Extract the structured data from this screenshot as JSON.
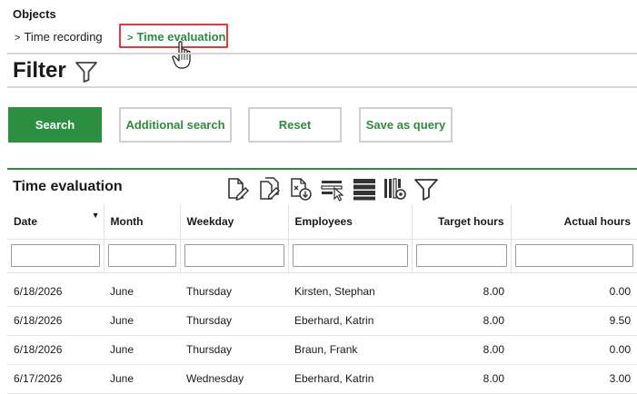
{
  "header": {
    "objects_label": "Objects",
    "nav": [
      {
        "label": "Time recording",
        "active": false
      },
      {
        "label": "Time evaluation",
        "active": true
      }
    ],
    "chevron": ">"
  },
  "filter": {
    "title": "Filter",
    "buttons": {
      "search": "Search",
      "additional_search": "Additional search",
      "reset": "Reset",
      "save_as_query": "Save as query"
    }
  },
  "section": {
    "title": "Time evaluation",
    "toolbar_icons": [
      "edit-document-icon",
      "copy-document-icon",
      "export-document-icon",
      "select-rows-icon",
      "list-view-icon",
      "column-settings-icon",
      "filter-icon"
    ]
  },
  "table": {
    "columns": [
      "Date",
      "Month",
      "Weekday",
      "Employees",
      "Target hours",
      "Actual hours"
    ],
    "sorted_column": "Date",
    "rows": [
      [
        "6/18/2026",
        "June",
        "Thursday",
        "Kirsten, Stephan",
        "8.00",
        "0.00"
      ],
      [
        "6/18/2026",
        "June",
        "Thursday",
        "Eberhard, Katrin",
        "8.00",
        "9.50"
      ],
      [
        "6/18/2026",
        "June",
        "Thursday",
        "Braun, Frank",
        "8.00",
        "0.00"
      ],
      [
        "6/17/2026",
        "June",
        "Wednesday",
        "Eberhard, Katrin",
        "8.00",
        "3.00"
      ]
    ]
  },
  "colors": {
    "accent_green": "#2b8e41",
    "highlight_red": "#e0393e"
  }
}
